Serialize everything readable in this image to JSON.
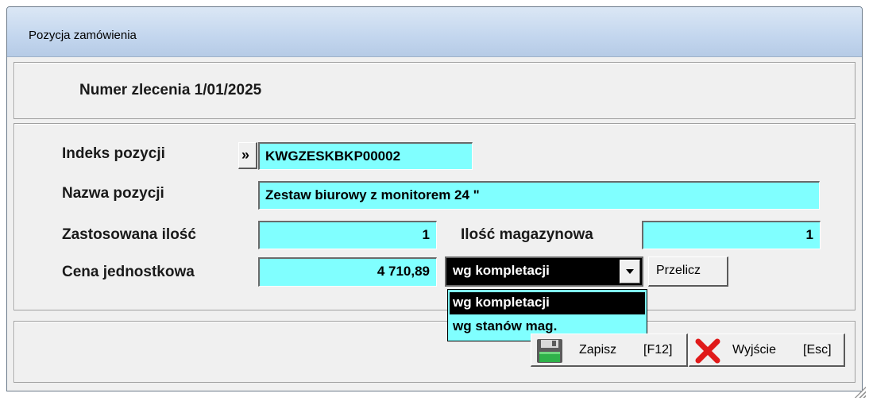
{
  "window": {
    "title": "Pozycja zamówienia"
  },
  "header": {
    "order_label": "Numer zlecenia 1/01/2025"
  },
  "form": {
    "index_label": "Indeks pozycji",
    "index_button": "»",
    "index_value": "KWGZESKBKP00002",
    "name_label": "Nazwa pozycji",
    "name_value": "Zestaw biurowy z monitorem 24 \"",
    "qty_label": "Zastosowana ilość",
    "qty_value": "1",
    "stock_label": "Ilość magazynowa",
    "stock_value": "1",
    "price_label": "Cena jednostkowa",
    "price_value": "4 710,89",
    "price_method_selected": "wg kompletacji",
    "price_method_options": [
      "wg kompletacji",
      "wg stanów mag."
    ],
    "recalc_button": "Przelicz"
  },
  "footer": {
    "save_label": "Zapisz",
    "save_key": "[F12]",
    "exit_label": "Wyjście",
    "exit_key": "[Esc]"
  },
  "icons": {
    "save": "floppy-disk-icon",
    "exit": "red-x-icon",
    "resize": "resize-grip-icon"
  },
  "colors": {
    "field_bg": "#80ffff",
    "selection_bg": "#000000",
    "titlebar": "#c3d6ee"
  }
}
